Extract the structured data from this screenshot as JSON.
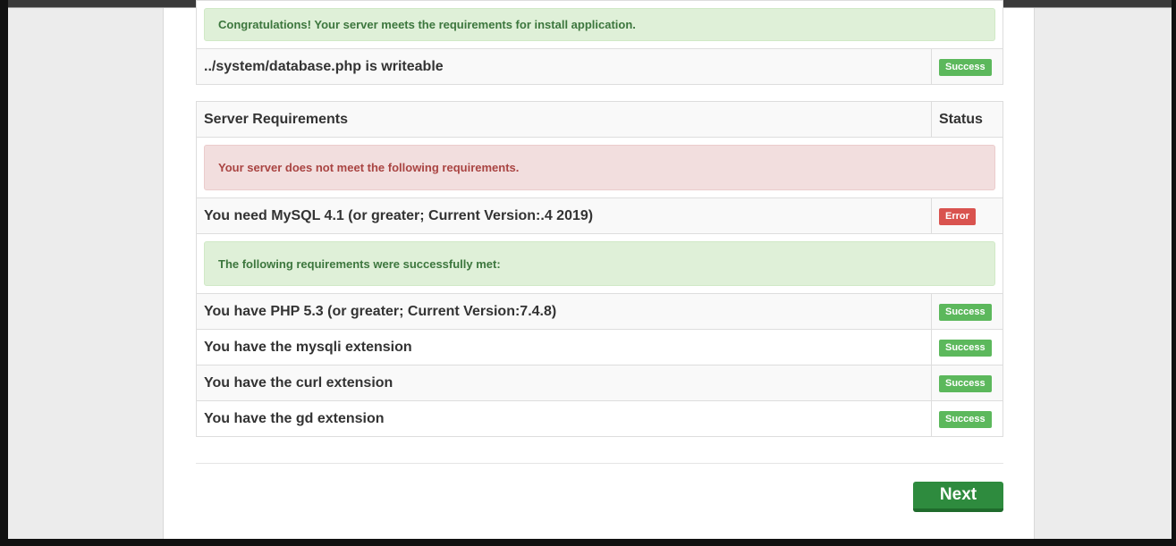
{
  "top_alert": "Congratulations! Your server meets the requirements for install application.",
  "writeable": {
    "text": "../system/database.php is writeable",
    "status": "Success"
  },
  "table": {
    "header_requirement": "Server Requirements",
    "header_status": "Status",
    "fail_message": "Your server does not meet the following requirements.",
    "failed": [
      {
        "text": "You need MySQL 4.1 (or greater; Current Version:.4 2019)",
        "status": "Error"
      }
    ],
    "success_message": "The following requirements were successfully met:",
    "met": [
      {
        "text": "You have PHP 5.3 (or greater; Current Version:7.4.8)",
        "status": "Success"
      },
      {
        "text": "You have the mysqli extension",
        "status": "Success"
      },
      {
        "text": "You have the curl extension",
        "status": "Success"
      },
      {
        "text": "You have the gd extension",
        "status": "Success"
      }
    ]
  },
  "next_label": "Next",
  "colors": {
    "success_badge": "#5cb85c",
    "error_badge": "#d9534f",
    "next_button": "#2e8b3e"
  }
}
